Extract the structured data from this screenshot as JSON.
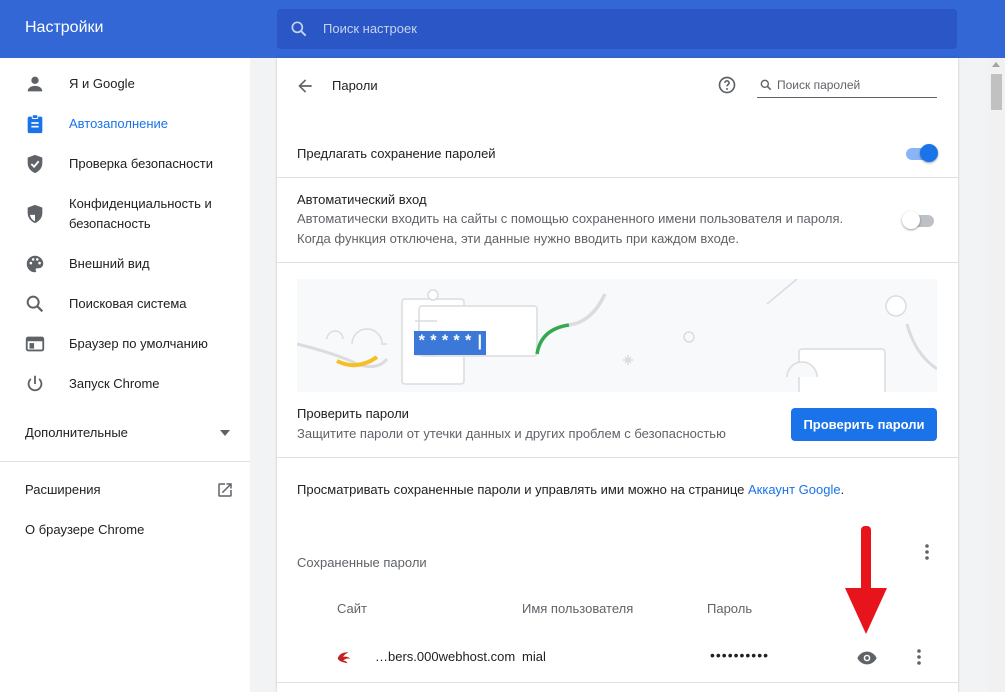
{
  "app": {
    "title": "Настройки"
  },
  "search": {
    "placeholder": "Поиск настроек"
  },
  "sidebar": {
    "items": [
      {
        "label": "Я и Google",
        "icon": "person-icon",
        "active": false
      },
      {
        "label": "Автозаполнение",
        "icon": "clipboard-icon",
        "active": true
      },
      {
        "label": "Проверка безопасности",
        "icon": "shield-icon",
        "active": false
      },
      {
        "label": "Конфиденциальность и безопасность",
        "icon": "shield-half-icon",
        "active": false
      },
      {
        "label": "Внешний вид",
        "icon": "palette-icon",
        "active": false
      },
      {
        "label": "Поисковая система",
        "icon": "search-icon",
        "active": false
      },
      {
        "label": "Браузер по умолчанию",
        "icon": "browser-window-icon",
        "active": false
      },
      {
        "label": "Запуск Chrome",
        "icon": "power-icon",
        "active": false
      }
    ],
    "advanced": "Дополнительные",
    "extensions": "Расширения",
    "about": "О браузере Chrome"
  },
  "passwords": {
    "title": "Пароли",
    "search_placeholder": "Поиск паролей",
    "offer_save": {
      "label": "Предлагать сохранение паролей",
      "enabled": true
    },
    "auto_signin": {
      "label": "Автоматический вход",
      "desc1": "Автоматически входить на сайты с помощью сохраненного имени пользователя и пароля.",
      "desc2": "Когда функция отключена, эти данные нужно вводить при каждом входе.",
      "enabled": false
    },
    "illustration": {
      "masked_text": "*****|"
    },
    "check": {
      "label": "Проверить пароли",
      "desc": "Защитите пароли от утечки данных и других проблем с безопасностью",
      "button": "Проверить пароли"
    },
    "account": {
      "text": "Просматривать сохраненные пароли и управлять ими можно на странице ",
      "link": "Аккаунт Google",
      "suffix": "."
    },
    "saved": {
      "title": "Сохраненные пароли",
      "columns": {
        "site": "Сайт",
        "username": "Имя пользователя",
        "password": "Пароль"
      },
      "rows": [
        {
          "site": "…bers.000webhost.com",
          "username": "mial",
          "password": "••••••••••"
        }
      ]
    }
  },
  "colors": {
    "accent": "#1a73e8",
    "header": "#3367d6",
    "annotation_arrow": "#e8141b"
  }
}
